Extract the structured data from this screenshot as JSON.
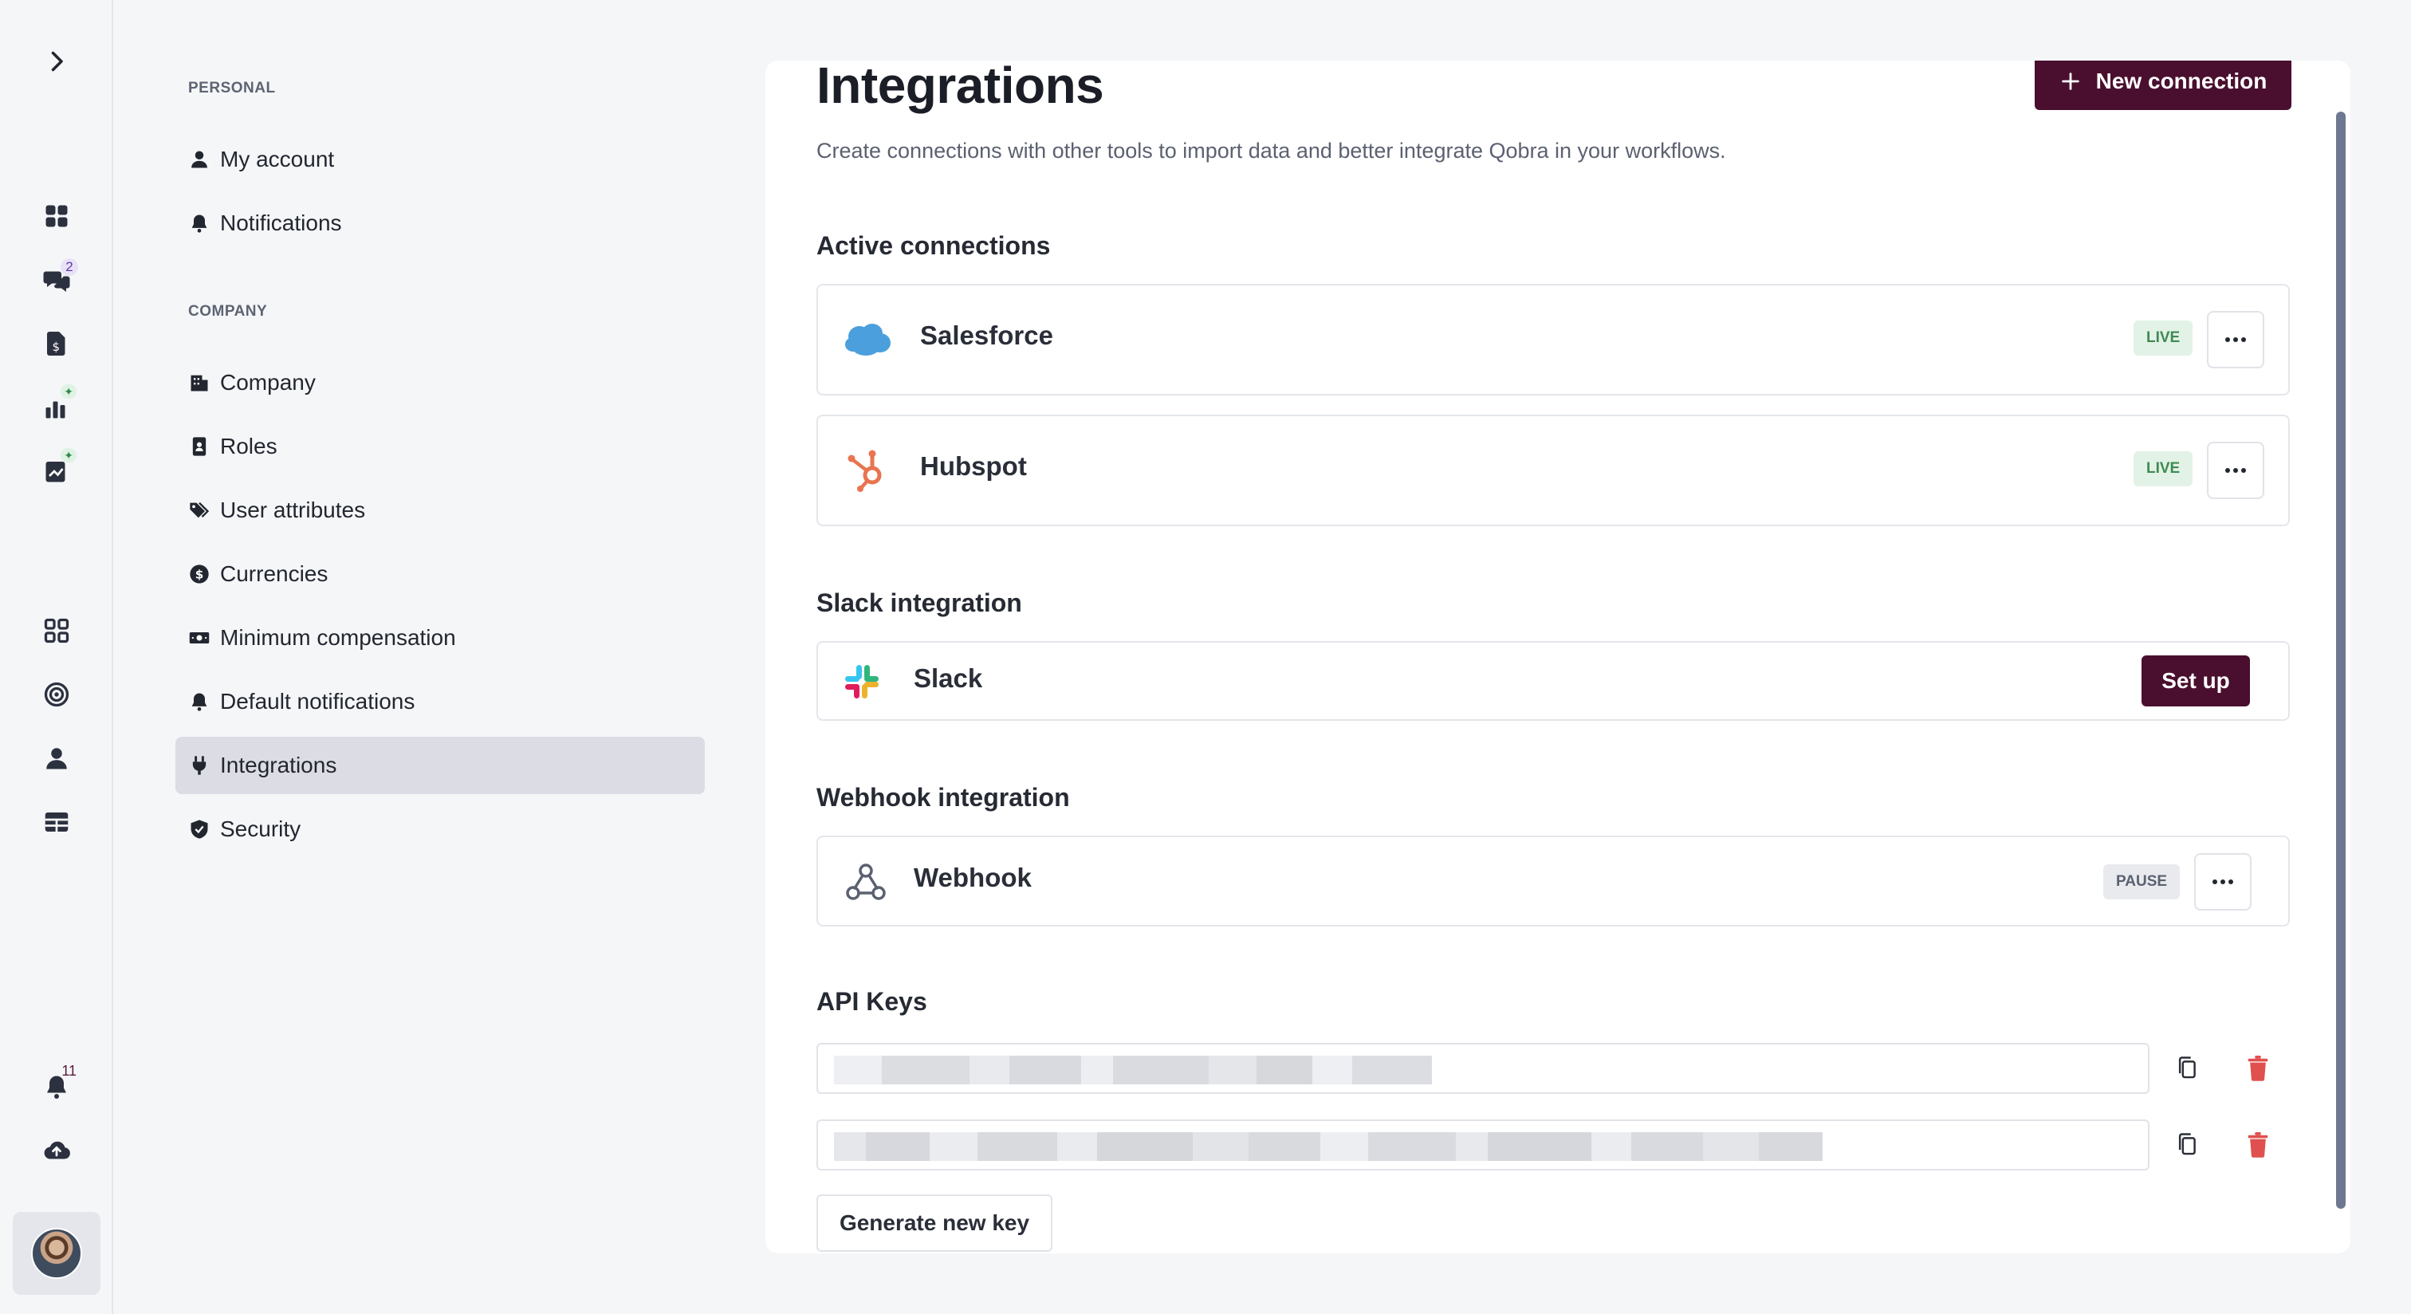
{
  "rail": {
    "items": [
      {
        "name": "expand-icon"
      },
      {
        "name": "dashboard-icon"
      },
      {
        "name": "chat-icon",
        "badge": "2"
      },
      {
        "name": "statement-icon"
      },
      {
        "name": "reports-icon"
      },
      {
        "name": "edit-chart-icon"
      },
      {
        "name": "apps-icon"
      },
      {
        "name": "target-icon"
      },
      {
        "name": "user-icon"
      },
      {
        "name": "table-icon"
      },
      {
        "name": "bell-icon",
        "badge": "11"
      },
      {
        "name": "cloud-upload-icon"
      }
    ]
  },
  "nav": {
    "personal_header": "PERSONAL",
    "company_header": "COMPANY",
    "items": [
      {
        "label": "My account",
        "icon": "user-icon"
      },
      {
        "label": "Notifications",
        "icon": "bell-icon"
      },
      {
        "label": "Company",
        "icon": "building-icon"
      },
      {
        "label": "Roles",
        "icon": "id-badge-icon"
      },
      {
        "label": "User attributes",
        "icon": "tags-icon"
      },
      {
        "label": "Currencies",
        "icon": "dollar-circle-icon"
      },
      {
        "label": "Minimum compensation",
        "icon": "money-bill-icon"
      },
      {
        "label": "Default notifications",
        "icon": "bell-icon"
      },
      {
        "label": "Integrations",
        "icon": "plug-icon",
        "active": true
      },
      {
        "label": "Security",
        "icon": "shield-icon"
      }
    ]
  },
  "main": {
    "title": "Integrations",
    "new_connection_label": "New connection",
    "subtitle": "Create connections with other tools to import data and better integrate Qobra in your workflows.",
    "active_header": "Active connections",
    "connections": [
      {
        "name": "Salesforce",
        "status": "LIVE",
        "logo": "salesforce-logo-icon"
      },
      {
        "name": "Hubspot",
        "status": "LIVE",
        "logo": "hubspot-logo-icon"
      }
    ],
    "slack_header": "Slack integration",
    "slack": {
      "name": "Slack",
      "action": "Set up"
    },
    "webhook_header": "Webhook integration",
    "webhook": {
      "name": "Webhook",
      "status": "PAUSE"
    },
    "api_header": "API Keys",
    "generate_label": "Generate new key"
  },
  "colors": {
    "brand": "#4a0f2e",
    "live_bg": "#e2f2e6",
    "live_text": "#3f8a52",
    "danger": "#e0504f"
  }
}
